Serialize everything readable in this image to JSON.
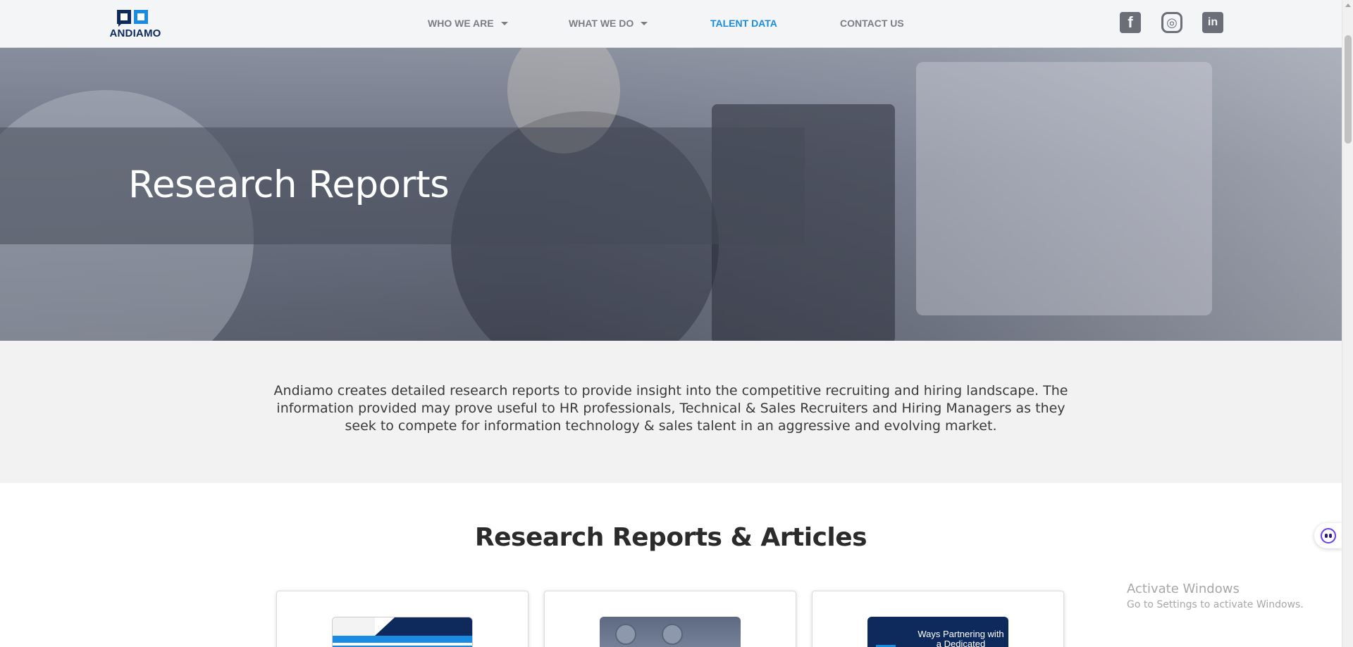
{
  "header": {
    "logo_text": "ANDIAMO",
    "nav": [
      {
        "label": "WHO WE ARE",
        "has_dropdown": true,
        "active": false
      },
      {
        "label": "WHAT WE DO",
        "has_dropdown": true,
        "active": false
      },
      {
        "label": "TALENT DATA",
        "has_dropdown": false,
        "active": true
      },
      {
        "label": "CONTACT US",
        "has_dropdown": false,
        "active": false
      }
    ],
    "social": [
      {
        "icon": "facebook-icon",
        "glyph": "f"
      },
      {
        "icon": "instagram-icon",
        "glyph": "◎"
      },
      {
        "icon": "linkedin-icon",
        "glyph": "in"
      }
    ]
  },
  "hero": {
    "title": "Research Reports"
  },
  "intro": {
    "text": "Andiamo creates detailed research reports to provide insight into the competitive recruiting and hiring landscape. The information provided may prove useful to HR professionals, Technical & Sales Recruiters and Hiring Managers as they seek to compete for information technology & sales talent in an aggressive and evolving market."
  },
  "reports": {
    "title": "Research Reports & Articles",
    "cards": [
      {
        "thumb_text": ""
      },
      {
        "thumb_text": ""
      },
      {
        "thumb_text": "Ways Partnering with a Dedicated"
      }
    ]
  },
  "watermark": {
    "line1": "Activate Windows",
    "line2": "Go to Settings to activate Windows."
  },
  "colors": {
    "brand_navy": "#0e2a5c",
    "brand_blue": "#1a8be2",
    "nav_gray": "#7a7d85"
  }
}
